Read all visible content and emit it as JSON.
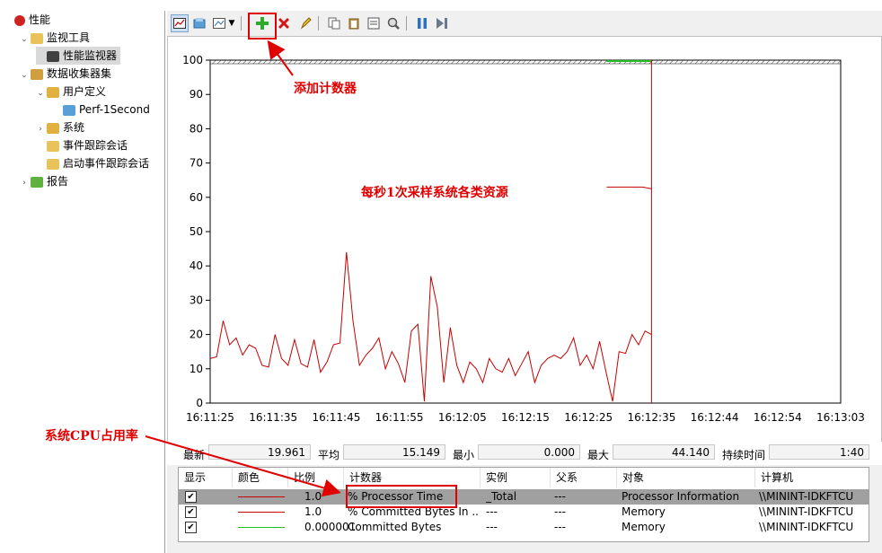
{
  "tree": {
    "items": [
      {
        "label": "性能",
        "level": 0,
        "twisty": "",
        "icon": "performance-icon",
        "color": "#cc2222"
      },
      {
        "label": "监视工具",
        "level": 1,
        "twisty": "⌄",
        "icon": "folder-icon",
        "color": "#e8c25a"
      },
      {
        "label": "性能监视器",
        "level": 2,
        "twisty": "",
        "icon": "monitor-chart-icon",
        "color": "#404040",
        "selected": true
      },
      {
        "label": "数据收集器集",
        "level": 1,
        "twisty": "⌄",
        "icon": "collector-icon",
        "color": "#d0a040"
      },
      {
        "label": "用户定义",
        "level": 2,
        "twisty": "⌄",
        "icon": "user-folder-icon",
        "color": "#e0b040"
      },
      {
        "label": "Perf-1Second",
        "level": 3,
        "twisty": "",
        "icon": "datacollector-icon",
        "color": "#5aa0d8"
      },
      {
        "label": "系统",
        "level": 2,
        "twisty": "›",
        "icon": "system-folder-icon",
        "color": "#e0b040"
      },
      {
        "label": "事件跟踪会话",
        "level": 2,
        "twisty": "",
        "icon": "trace-folder-icon",
        "color": "#e8c25a"
      },
      {
        "label": "启动事件跟踪会话",
        "level": 2,
        "twisty": "",
        "icon": "startup-trace-folder-icon",
        "color": "#e8c25a"
      },
      {
        "label": "报告",
        "level": 1,
        "twisty": "›",
        "icon": "report-icon",
        "color": "#60b040"
      }
    ]
  },
  "toolbar": {
    "view_graph": "view-graph-icon",
    "copy_props": "copy-properties-icon",
    "change_type": "change-graph-type-icon",
    "add": "+",
    "delete": "✕",
    "highlight": "highlight-icon",
    "copy": "copy-icon",
    "paste": "paste-icon",
    "props": "properties-icon",
    "zoom": "zoom-icon",
    "freeze": "pause-icon",
    "update": "update-icon"
  },
  "chart_data": {
    "type": "line",
    "ylim": [
      0,
      100
    ],
    "yticks": [
      "0",
      "10",
      "20",
      "30",
      "40",
      "50",
      "60",
      "70",
      "80",
      "90",
      "100"
    ],
    "xticks": [
      "16:11:25",
      "16:11:35",
      "16:11:45",
      "16:11:55",
      "16:12:05",
      "16:12:15",
      "16:12:25",
      "16:12:35",
      "16:12:44",
      "16:12:54",
      "16:13:03"
    ],
    "series": [
      {
        "color": "#c80000",
        "values": [
          13,
          13.5,
          24,
          17,
          19,
          14,
          17,
          16,
          11,
          10.5,
          20,
          13,
          11,
          18.5,
          11.5,
          10.5,
          18.5,
          9,
          12,
          17,
          17.5,
          44,
          24,
          11,
          14,
          16,
          19,
          10,
          15,
          11.5,
          6,
          21,
          23,
          0.5,
          37,
          28,
          6,
          22,
          11,
          6,
          12,
          10,
          6,
          13,
          10,
          9,
          13,
          8,
          11.5,
          15,
          6,
          11,
          13,
          14,
          13,
          15,
          19,
          11,
          14,
          10,
          18,
          9,
          0.5,
          15,
          14.5,
          20,
          17,
          21,
          20
        ]
      },
      {
        "color": "#c80000",
        "values": [
          63,
          63,
          63,
          63,
          63,
          62.5
        ]
      }
    ],
    "cursor_position": "16:12:35"
  },
  "stats": {
    "latest_label": "最新",
    "latest": "19.961",
    "avg_label": "平均",
    "avg": "15.149",
    "min_label": "最小",
    "min": "0.000",
    "max_label": "最大",
    "max": "44.140",
    "dur_label": "持续时间",
    "dur": "1:40"
  },
  "table": {
    "headers": [
      "显示",
      "颜色",
      "比例",
      "计数器",
      "实例",
      "父系",
      "对象",
      "计算机"
    ],
    "rows": [
      {
        "check": "✔",
        "color": "#c80000",
        "scale": "1.0",
        "counter": "% Processor Time",
        "instance": "_Total",
        "parent": "---",
        "object": "Processor Information",
        "computer": "\\\\MININT-IDKFTCU",
        "selected": true
      },
      {
        "check": "✔",
        "color": "#c80000",
        "scale": "1.0",
        "counter": "% Committed Bytes In ...",
        "instance": "---",
        "parent": "---",
        "object": "Memory",
        "computer": "\\\\MININT-IDKFTCU"
      },
      {
        "check": "✔",
        "color": "#22c022",
        "scale": "0.000001",
        "counter": "Committed Bytes",
        "instance": "---",
        "parent": "---",
        "object": "Memory",
        "computer": "\\\\MININT-IDKFTCU"
      }
    ]
  },
  "annotations": {
    "add_counter": "添加计数器",
    "sampling": "每秒1次采样系统各类资源",
    "cpu_usage": "系统CPU占用率"
  }
}
